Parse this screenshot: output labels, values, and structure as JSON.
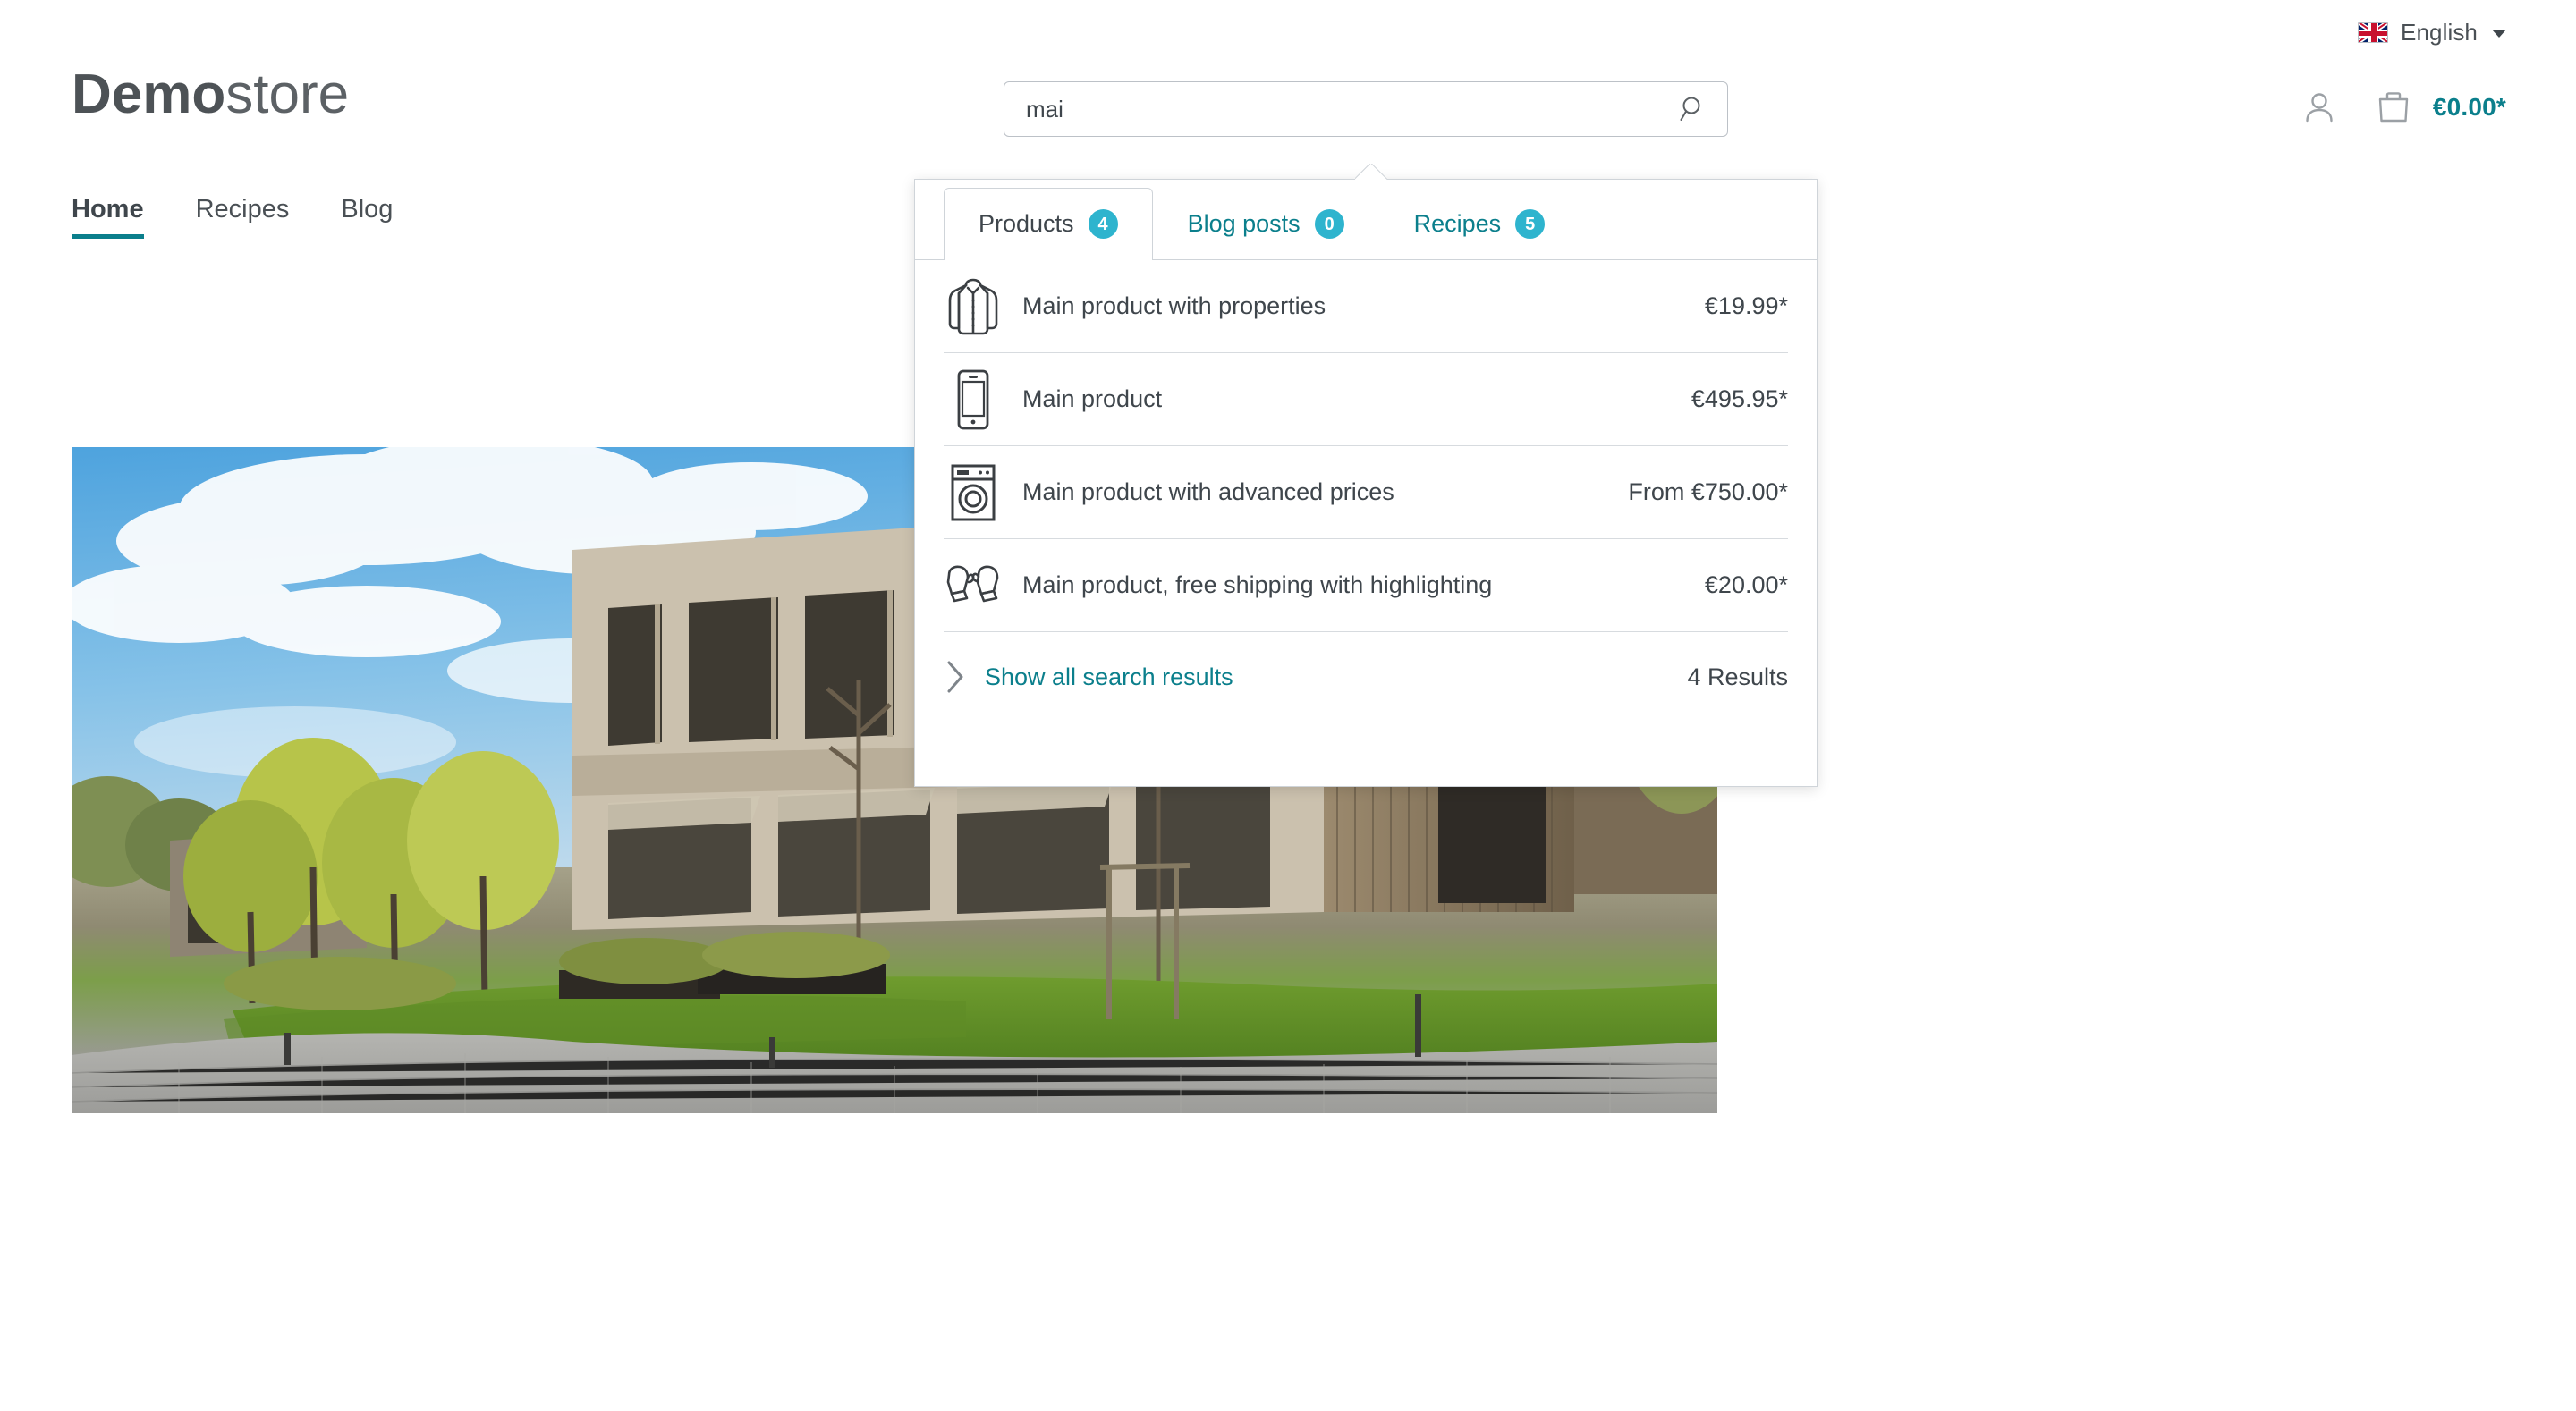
{
  "topbar": {
    "language_label": "English",
    "flag_icon": "uk-flag-icon",
    "caret_icon": "chevron-down-icon"
  },
  "header": {
    "logo_bold": "Demo",
    "logo_light": "store",
    "search": {
      "value": "mai",
      "placeholder": "",
      "icon": "search-icon"
    },
    "account_icon": "user-account-icon",
    "cart_icon": "shopping-bag-icon",
    "cart_amount": "€0.00*"
  },
  "nav": {
    "items": [
      {
        "label": "Home",
        "active": true
      },
      {
        "label": "Recipes",
        "active": false
      },
      {
        "label": "Blog",
        "active": false
      }
    ]
  },
  "search_dropdown": {
    "tabs": [
      {
        "label": "Products",
        "count": "4",
        "active": true
      },
      {
        "label": "Blog posts",
        "count": "0",
        "active": false
      },
      {
        "label": "Recipes",
        "count": "5",
        "active": false
      }
    ],
    "results": [
      {
        "icon": "jacket-icon",
        "name": "Main product with properties",
        "price": "€19.99*"
      },
      {
        "icon": "smartphone-icon",
        "name": "Main product",
        "price": "€495.95*"
      },
      {
        "icon": "washing-machine-icon",
        "name": "Main product with advanced prices",
        "price": "From €750.00*"
      },
      {
        "icon": "mittens-icon",
        "name": "Main product, free shipping with highlighting",
        "price": "€20.00*"
      }
    ],
    "footer": {
      "chevron_icon": "chevron-right-icon",
      "link_label": "Show all search results",
      "count_label": "4 Results"
    }
  },
  "hero": {
    "alt": "modern wooden office building with trees, lawn and paved path under a blue cloudy sky"
  },
  "colors": {
    "accent_teal": "#0b7f8c",
    "badge_cyan": "#2eb4ce",
    "text_dark": "#3f464c",
    "border_gray": "#cfd4d9"
  }
}
